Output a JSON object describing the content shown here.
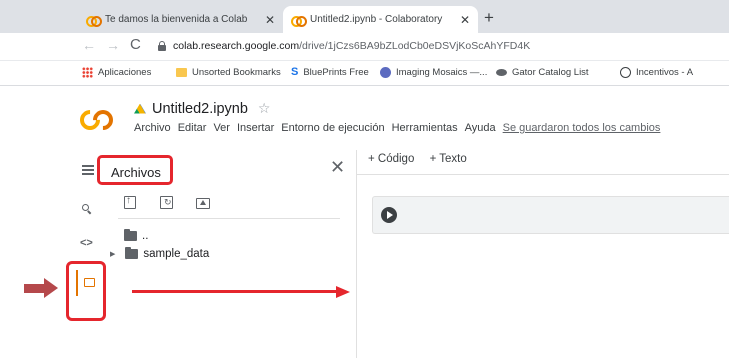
{
  "browser": {
    "tabs": [
      {
        "title": "Te damos la bienvenida a Colab",
        "close": "✕"
      },
      {
        "title": "Untitled2.ipynb - Colaboratory",
        "close": "✕"
      }
    ],
    "new_tab": "+",
    "nav": {
      "back": "←",
      "forward": "→",
      "reload": "C"
    },
    "url_host": "colab.research.google.com",
    "url_path": "/drive/1jCzs6BA9bZLodCb0eDSVjKoScAhYFD4K",
    "bookmarks": [
      "Aplicaciones",
      "Unsorted Bookmarks",
      "BluePrints Free",
      "Imaging Mosaics —...",
      "Gator Catalog List",
      "Incentivos - A"
    ]
  },
  "colab": {
    "notebook_title": "Untitled2.ipynb",
    "star": "☆",
    "menu": [
      "Archivo",
      "Editar",
      "Ver",
      "Insertar",
      "Entorno de ejecución",
      "Herramientas",
      "Ayuda"
    ],
    "saved_status": "Se guardaron todos los cambios"
  },
  "files_panel": {
    "title": "Archivos",
    "close": "✕",
    "parent_dir": "..",
    "items": [
      "sample_data"
    ]
  },
  "notebook": {
    "add_code": "+ Código",
    "add_text": "+ Texto"
  },
  "rail": {
    "code_glyph": "<>"
  },
  "colors": {
    "highlight": "#e5262d",
    "arrow_left": "#b5484b",
    "colab_orange": "#e37400",
    "colab_yellow": "#f9ab00"
  }
}
